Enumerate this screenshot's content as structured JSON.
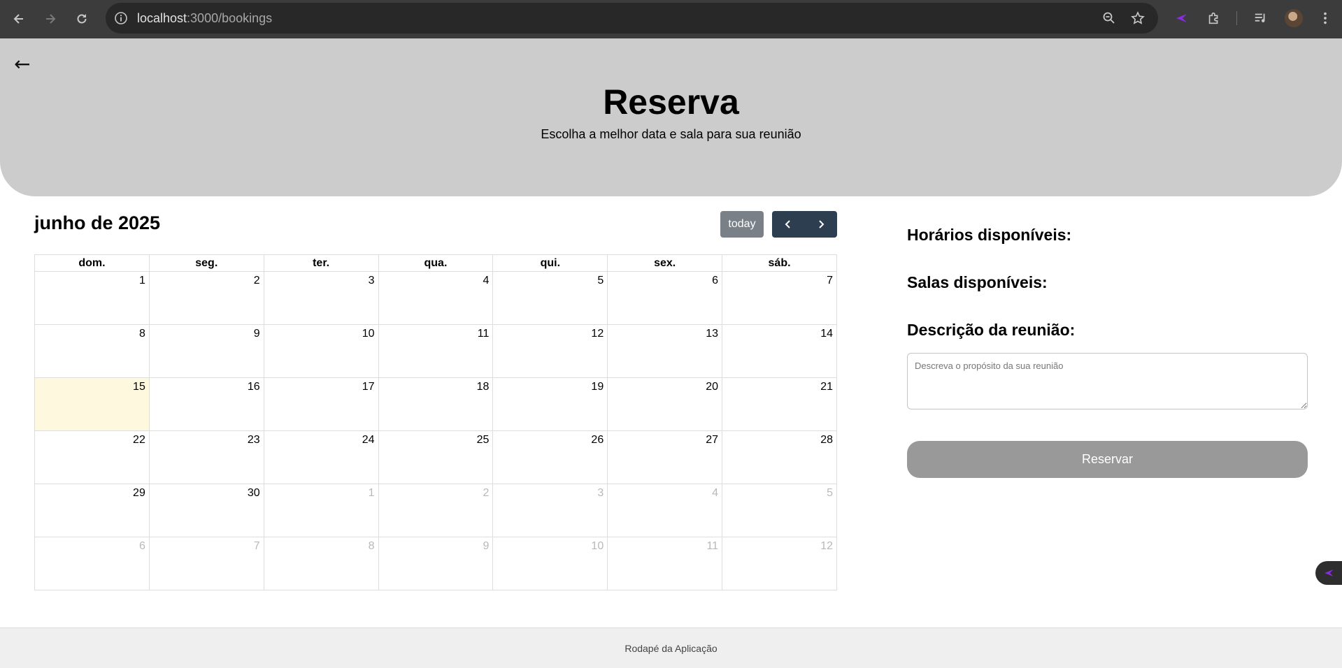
{
  "browser": {
    "url_host": "localhost",
    "url_path": ":3000/bookings"
  },
  "header": {
    "back_arrow": "←",
    "title": "Reserva",
    "subtitle": "Escolha a melhor data e sala para sua reunião"
  },
  "calendar": {
    "title": "junho de 2025",
    "today_label": "today",
    "weekdays": [
      "dom.",
      "seg.",
      "ter.",
      "qua.",
      "qui.",
      "sex.",
      "sáb."
    ],
    "weeks": [
      [
        {
          "d": "1"
        },
        {
          "d": "2"
        },
        {
          "d": "3"
        },
        {
          "d": "4"
        },
        {
          "d": "5"
        },
        {
          "d": "6"
        },
        {
          "d": "7"
        }
      ],
      [
        {
          "d": "8"
        },
        {
          "d": "9"
        },
        {
          "d": "10"
        },
        {
          "d": "11"
        },
        {
          "d": "12"
        },
        {
          "d": "13"
        },
        {
          "d": "14"
        }
      ],
      [
        {
          "d": "15",
          "today": true
        },
        {
          "d": "16"
        },
        {
          "d": "17"
        },
        {
          "d": "18"
        },
        {
          "d": "19"
        },
        {
          "d": "20"
        },
        {
          "d": "21"
        }
      ],
      [
        {
          "d": "22"
        },
        {
          "d": "23"
        },
        {
          "d": "24"
        },
        {
          "d": "25"
        },
        {
          "d": "26"
        },
        {
          "d": "27"
        },
        {
          "d": "28"
        }
      ],
      [
        {
          "d": "29"
        },
        {
          "d": "30"
        },
        {
          "d": "1",
          "other": true
        },
        {
          "d": "2",
          "other": true
        },
        {
          "d": "3",
          "other": true
        },
        {
          "d": "4",
          "other": true
        },
        {
          "d": "5",
          "other": true
        }
      ],
      [
        {
          "d": "6",
          "other": true
        },
        {
          "d": "7",
          "other": true
        },
        {
          "d": "8",
          "other": true
        },
        {
          "d": "9",
          "other": true
        },
        {
          "d": "10",
          "other": true
        },
        {
          "d": "11",
          "other": true
        },
        {
          "d": "12",
          "other": true
        }
      ]
    ]
  },
  "panel": {
    "times_label": "Horários disponíveis:",
    "rooms_label": "Salas disponíveis:",
    "description_label": "Descrição da reunião:",
    "description_placeholder": "Descreva o propósito da sua reunião",
    "description_value": "",
    "reserve_label": "Reservar"
  },
  "footer": {
    "text": "Rodapé da Aplicação"
  },
  "colors": {
    "header_bg": "#cccccc",
    "today_highlight": "#fef8de",
    "nav_button": "#2c3e50",
    "today_button": "#7a8088",
    "reserve_button": "#999999",
    "footer_bg": "#efefef",
    "accent_extension": "#8a2be2"
  }
}
